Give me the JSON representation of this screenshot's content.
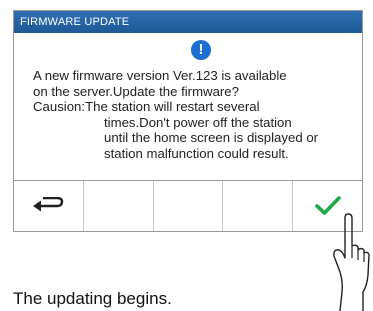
{
  "title_bar": {
    "title": "FIRMWARE UPDATE"
  },
  "dialog": {
    "icon": "exclamation-info-icon",
    "icon_color": "#1a6fd1",
    "line1": "A new firmware version Ver.123 is available",
    "line2": "on the server.Update the firmware?",
    "caution_label": "Causion:",
    "caution_line1": "The station will restart several",
    "caution_line2": "times.Don't power off the station",
    "caution_line3": "until the home screen is displayed or",
    "caution_line4": "station malfunction could result."
  },
  "buttons": [
    {
      "name": "back-button",
      "icon": "return-arrow-icon"
    },
    {
      "name": "blank-button-2",
      "icon": ""
    },
    {
      "name": "blank-button-3",
      "icon": ""
    },
    {
      "name": "blank-button-4",
      "icon": ""
    },
    {
      "name": "confirm-button",
      "icon": "checkmark-icon",
      "icon_color": "#1ea84a"
    }
  ],
  "caption": {
    "text": "The updating begins."
  }
}
